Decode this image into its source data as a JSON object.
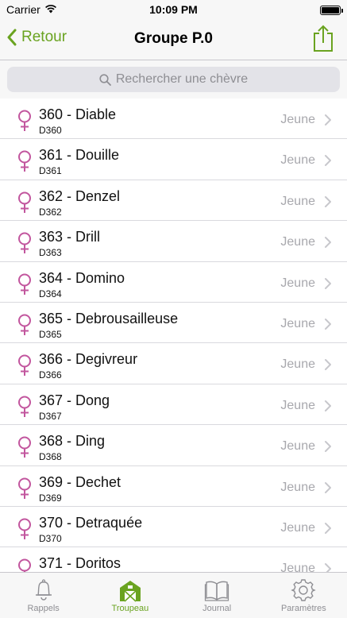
{
  "status_bar": {
    "carrier": "Carrier",
    "time": "10:09 PM"
  },
  "nav": {
    "back_label": "Retour",
    "title": "Groupe P.0"
  },
  "search": {
    "placeholder": "Rechercher une chèvre"
  },
  "goats": [
    {
      "name": "360 - Diable",
      "code": "D360",
      "status": "Jeune"
    },
    {
      "name": "361 - Douille",
      "code": "D361",
      "status": "Jeune"
    },
    {
      "name": "362 - Denzel",
      "code": "D362",
      "status": "Jeune"
    },
    {
      "name": "363 - Drill",
      "code": "D363",
      "status": "Jeune"
    },
    {
      "name": "364 - Domino",
      "code": "D364",
      "status": "Jeune"
    },
    {
      "name": "365 - Debrousailleuse",
      "code": "D365",
      "status": "Jeune"
    },
    {
      "name": "366 - Degivreur",
      "code": "D366",
      "status": "Jeune"
    },
    {
      "name": "367 - Dong",
      "code": "D367",
      "status": "Jeune"
    },
    {
      "name": "368 - Ding",
      "code": "D368",
      "status": "Jeune"
    },
    {
      "name": "369 - Dechet",
      "code": "D369",
      "status": "Jeune"
    },
    {
      "name": "370 - Detraquée",
      "code": "D370",
      "status": "Jeune"
    },
    {
      "name": "371 - Doritos",
      "code": "",
      "status": "Jeune"
    }
  ],
  "tabs": [
    {
      "label": "Rappels",
      "icon": "bell-icon"
    },
    {
      "label": "Troupeau",
      "icon": "barn-icon",
      "active": true
    },
    {
      "label": "Journal",
      "icon": "book-icon"
    },
    {
      "label": "Paramètres",
      "icon": "gear-icon"
    }
  ],
  "colors": {
    "accent": "#6aa320",
    "female_symbol": "#c2569e",
    "status_text": "#a8a8ad"
  }
}
